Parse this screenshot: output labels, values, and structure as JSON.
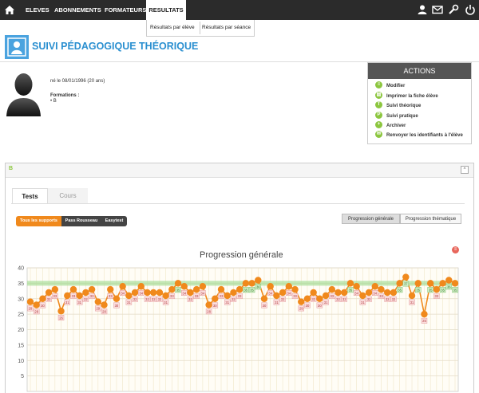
{
  "nav": {
    "items": [
      "ELEVES",
      "ABONNEMENTS",
      "FORMATEURS"
    ],
    "active": "RESULTATS",
    "submenu": [
      "Résultats par élève",
      "Résultats par séance"
    ]
  },
  "page": {
    "title": "SUIVI PÉDAGOGIQUE THÉORIQUE"
  },
  "student": {
    "born": "né le 08/01/1996 (20 ans)",
    "formations_label": "Formations :",
    "formation_item": "B"
  },
  "actions": {
    "title": "ACTIONS",
    "items": [
      {
        "label": "Modifier",
        "glyph": "≡"
      },
      {
        "label": "Imprimer la fiche élève",
        "glyph": "▤"
      },
      {
        "label": "Suivi théorique",
        "glyph": "T"
      },
      {
        "label": "Suivi pratique",
        "glyph": "P"
      },
      {
        "label": "Archiver",
        "glyph": "+"
      },
      {
        "label": "Renvoyer les identifiants à l'élève",
        "glyph": "✉"
      }
    ]
  },
  "panel": {
    "label": "B",
    "collapse_glyph": "^"
  },
  "tabs": [
    "Tests",
    "Cours"
  ],
  "supports": [
    "Tous les supports",
    "Pass Rousseau",
    "Easytest"
  ],
  "views": [
    "Progression générale",
    "Progression thématique"
  ],
  "chart_data": {
    "type": "line",
    "title": "Progression générale",
    "ylim": [
      0,
      40
    ],
    "yticks": [
      5,
      10,
      15,
      20,
      25,
      30,
      35,
      40
    ],
    "threshold": 35,
    "grid": true,
    "series": [
      {
        "values": [
          29,
          28,
          30,
          32,
          33,
          26,
          31,
          33,
          31,
          32,
          33,
          29,
          28,
          33,
          30,
          34,
          31,
          32,
          34,
          32,
          32,
          32,
          31,
          33,
          35,
          34,
          32,
          33,
          34,
          28,
          30,
          33,
          31,
          32,
          33,
          35,
          35,
          36,
          30,
          34,
          31,
          32,
          34,
          33,
          29,
          30,
          32,
          30,
          31,
          33,
          32,
          32,
          35,
          34,
          31,
          32,
          34,
          33,
          32,
          32,
          35,
          37,
          31,
          35,
          25,
          35,
          33,
          35,
          36,
          35
        ]
      }
    ]
  }
}
